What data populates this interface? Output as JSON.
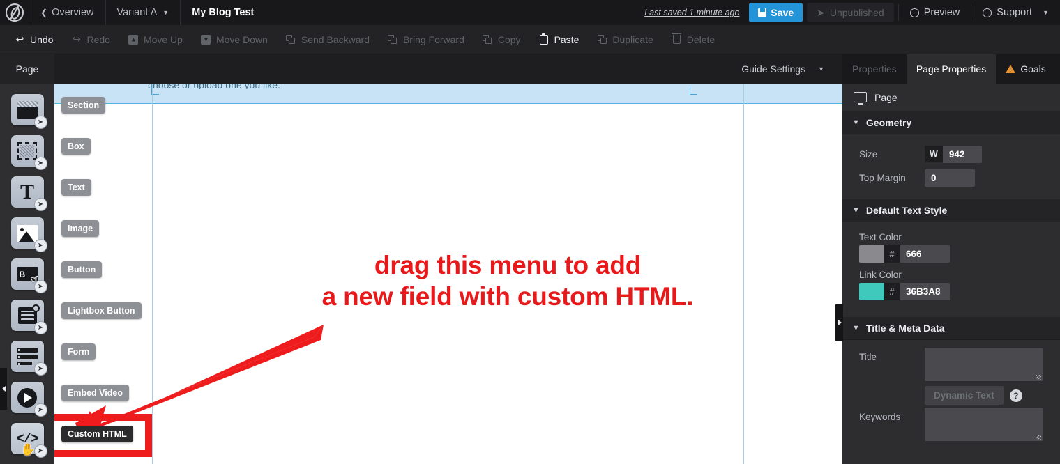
{
  "header": {
    "logo": "unbounce-logo",
    "back_label": "Overview",
    "variant_label": "Variant A",
    "page_title": "My Blog Test",
    "last_saved": "Last saved  1 minute ago",
    "save_label": "Save",
    "unpublished_label": "Unpublished",
    "preview_label": "Preview",
    "support_label": "Support"
  },
  "toolbar": {
    "items": [
      {
        "label": "Undo",
        "icon": "undo-arrow-icon",
        "enabled": true
      },
      {
        "label": "Redo",
        "icon": "redo-arrow-icon",
        "enabled": false
      },
      {
        "label": "Move Up",
        "icon": "arrow-up-square-icon",
        "enabled": false
      },
      {
        "label": "Move Down",
        "icon": "arrow-down-square-icon",
        "enabled": false
      },
      {
        "label": "Send Backward",
        "icon": "layers-back-icon",
        "enabled": false
      },
      {
        "label": "Bring Forward",
        "icon": "layers-front-icon",
        "enabled": false
      },
      {
        "label": "Copy",
        "icon": "copy-icon",
        "enabled": false
      },
      {
        "label": "Paste",
        "icon": "paste-icon",
        "enabled": true
      },
      {
        "label": "Duplicate",
        "icon": "duplicate-icon",
        "enabled": false
      },
      {
        "label": "Delete",
        "icon": "trash-icon",
        "enabled": false
      }
    ]
  },
  "rail": {
    "tab_label": "Page",
    "tools": [
      {
        "label": "Section",
        "icon": "section-icon"
      },
      {
        "label": "Box",
        "icon": "box-icon"
      },
      {
        "label": "Text",
        "icon": "text-icon"
      },
      {
        "label": "Image",
        "icon": "image-icon"
      },
      {
        "label": "Button",
        "icon": "button-icon"
      },
      {
        "label": "Lightbox Button",
        "icon": "lightbox-button-icon"
      },
      {
        "label": "Form",
        "icon": "form-icon"
      },
      {
        "label": "Embed Video",
        "icon": "embed-video-icon"
      },
      {
        "label": "Custom HTML",
        "icon": "code-brackets-icon"
      }
    ]
  },
  "canvas": {
    "guide_settings_label": "Guide Settings",
    "clipped_text": "choose or upload one you like.",
    "annotation_line1": "drag this menu to add",
    "annotation_line2": "a new field with custom HTML.",
    "annotation_color": "#E8191B",
    "highlight_color": "#9ACCEE",
    "guide_color": "#9FD0E8"
  },
  "properties": {
    "tabs": [
      {
        "label": "Properties",
        "active": false
      },
      {
        "label": "Page Properties",
        "active": true
      },
      {
        "label": "Goals",
        "active": false,
        "icon": "warning-triangle-icon"
      }
    ],
    "object_label": "Page",
    "object_icon": "monitor-icon",
    "sections": [
      {
        "title": "Geometry",
        "fields": [
          {
            "label": "Size",
            "prefix": "W",
            "value": "942"
          },
          {
            "label": "Top Margin",
            "value": "0"
          }
        ]
      },
      {
        "title": "Default Text Style",
        "colors": [
          {
            "label": "Text Color",
            "hash": "#",
            "value": "666",
            "swatch": "#8a8a8e"
          },
          {
            "label": "Link Color",
            "hash": "#",
            "value": "36B3A8",
            "swatch": "#3FC9BC"
          }
        ]
      },
      {
        "title": "Title & Meta Data",
        "meta": [
          {
            "label": "Title",
            "value": ""
          },
          {
            "label": "Keywords",
            "value": ""
          }
        ],
        "dynamic_text_label": "Dynamic Text",
        "help_label": "?"
      }
    ]
  }
}
